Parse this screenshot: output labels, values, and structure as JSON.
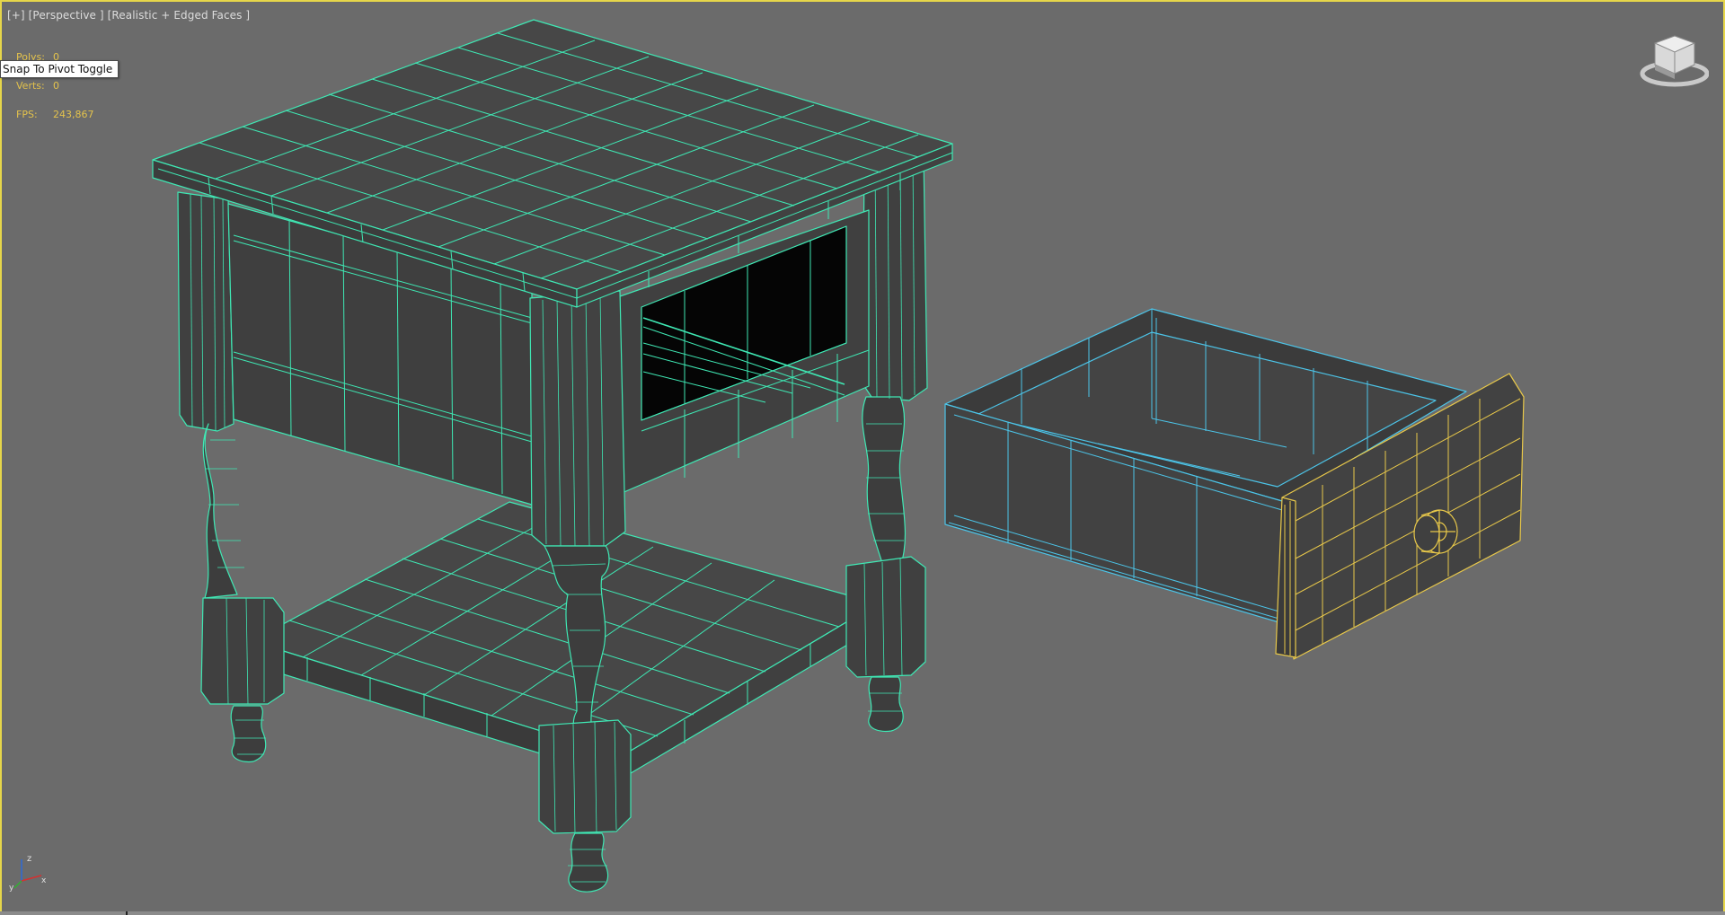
{
  "viewport": {
    "label": "[+] [Perspective ] [Realistic + Edged Faces ]",
    "border_color": "#e6d64a",
    "background": "#6b6b6b"
  },
  "stats": {
    "polys_label": "Polys:",
    "polys_value": "0",
    "verts_label": "Verts:",
    "verts_value": "0",
    "fps_label": "FPS:",
    "fps_value": "243,867"
  },
  "tooltip": {
    "text": "Snap To Pivot Toggle"
  },
  "axis": {
    "x": "x",
    "y": "y",
    "z": "z"
  },
  "viewcube": {
    "icon": "viewcube-icon"
  },
  "colors": {
    "table_wire": "#3fe8b4",
    "drawer_box_wire": "#4cc4e8",
    "drawer_front_wire": "#e8c84a",
    "face_dark": "#404040",
    "face_mid": "#4a4a4a",
    "face_black": "#050505"
  }
}
